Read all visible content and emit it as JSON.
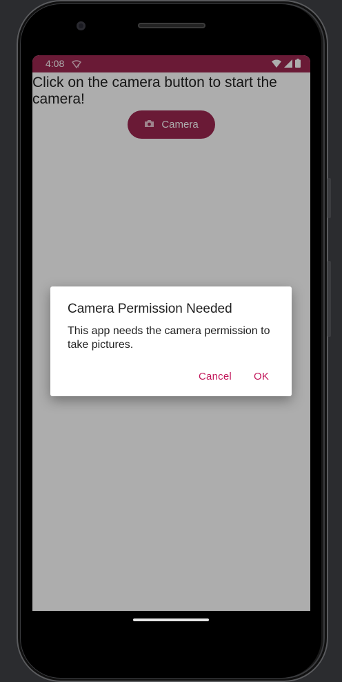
{
  "status_bar": {
    "time": "4:08",
    "left_icon": "wifi-question-icon",
    "right_icons": [
      "wifi-icon",
      "signal-icon",
      "battery-icon"
    ],
    "color": "#9c2750"
  },
  "main": {
    "prompt": "Click on the camera button to start the camera!",
    "camera_button": {
      "label": "Camera",
      "icon": "camera-icon",
      "color": "#9c2750"
    }
  },
  "dialog": {
    "title": "Camera Permission Needed",
    "message": "This app needs the camera permission to take pictures.",
    "cancel_label": "Cancel",
    "ok_label": "OK",
    "accent": "#c2185b"
  }
}
